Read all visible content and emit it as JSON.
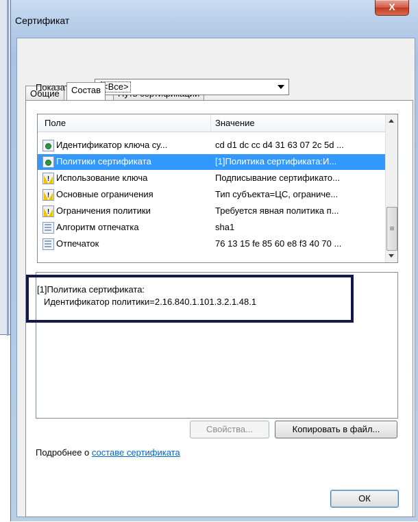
{
  "window": {
    "title": "Сертификат",
    "close_label": "X"
  },
  "tabs": [
    {
      "label": "Общие",
      "active": false
    },
    {
      "label": "Состав",
      "active": true
    },
    {
      "label": "Путь сертификации",
      "active": false
    }
  ],
  "show": {
    "label": "Показать:",
    "selected": "<Все>"
  },
  "list": {
    "columns": [
      "Поле",
      "Значение"
    ],
    "rows": [
      {
        "icon": "key-icon",
        "field": "Идентификатор ключа су...",
        "value": "cd d1 dc cc d4 31 63 07 2c 5d ...",
        "selected": false
      },
      {
        "icon": "key-icon",
        "field": "Политики сертификата",
        "value": "[1]Политика сертификата:И...",
        "selected": true
      },
      {
        "icon": "warning-icon",
        "field": "Использование ключа",
        "value": "Подписывание сертификато...",
        "selected": false
      },
      {
        "icon": "warning-icon",
        "field": "Основные ограничения",
        "value": "Тип субъекта=ЦС, ограниче...",
        "selected": false
      },
      {
        "icon": "warning-icon",
        "field": "Ограничения политики",
        "value": "Требуется явная политика п...",
        "selected": false
      },
      {
        "icon": "certificate-field-icon",
        "field": "Алгоритм отпечатка",
        "value": "sha1",
        "selected": false
      },
      {
        "icon": "certificate-field-icon",
        "field": "Отпечаток",
        "value": "76 13 15 fe 85 60 e8 f3 40 70 ...",
        "selected": false
      }
    ]
  },
  "details": {
    "line1": "[1]Политика сертификата:",
    "line2": "Идентификатор политики=2.16.840.1.101.3.2.1.48.1"
  },
  "buttons": {
    "properties": "Свойства...",
    "copy_to_file": "Копировать в файл...",
    "ok": "ОК"
  },
  "more": {
    "prefix": "Подробнее о ",
    "link": "составе сертификата"
  }
}
